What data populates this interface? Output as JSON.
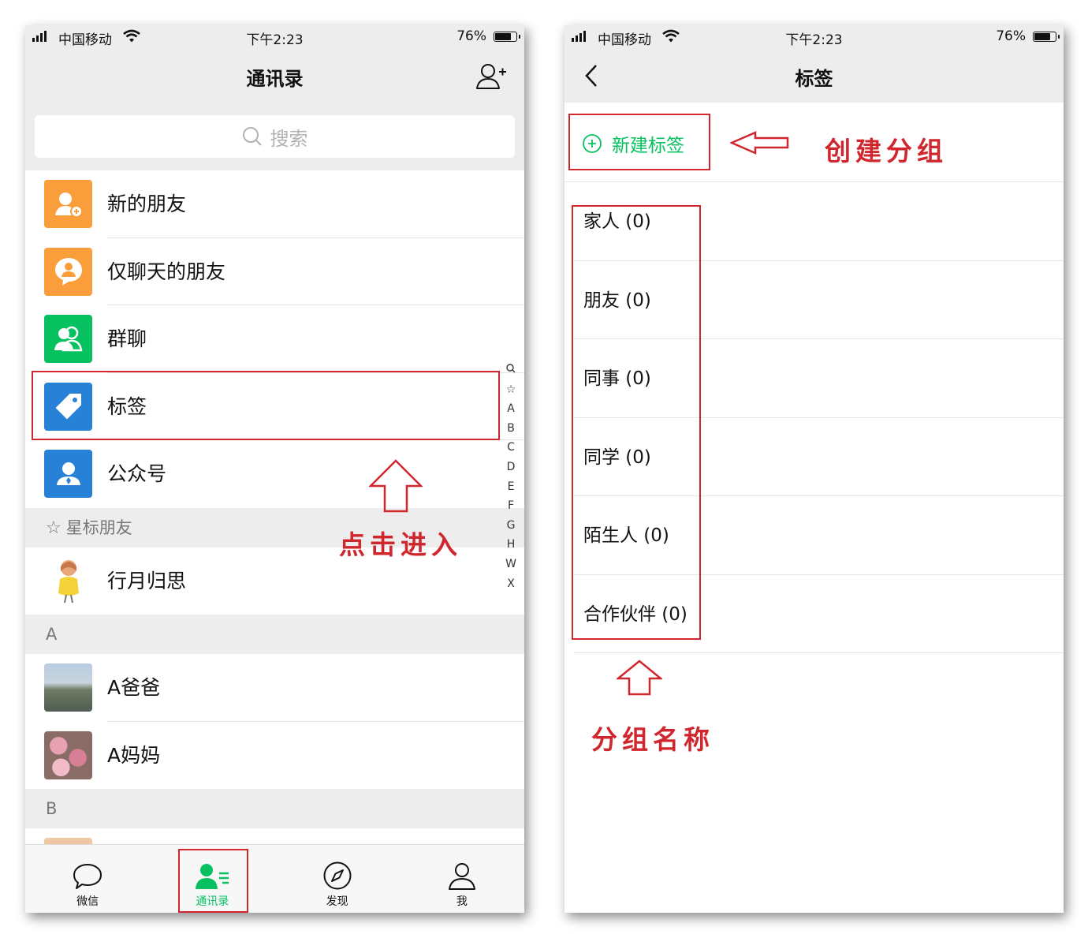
{
  "status_bar": {
    "carrier": "中国移动",
    "time": "下午2:23",
    "battery": "76%"
  },
  "left": {
    "title": "通讯录",
    "search_placeholder": "搜索",
    "menu": [
      {
        "label": "新的朋友",
        "icon": "add-friend-icon",
        "color": "#fa9d3b"
      },
      {
        "label": "仅聊天的朋友",
        "icon": "chat-only-icon",
        "color": "#fa9d3b"
      },
      {
        "label": "群聊",
        "icon": "group-chat-icon",
        "color": "#07c160"
      },
      {
        "label": "标签",
        "icon": "tag-icon",
        "color": "#2782d7"
      },
      {
        "label": "公众号",
        "icon": "official-account-icon",
        "color": "#2782d7"
      }
    ],
    "starred_header": "星标朋友",
    "starred": [
      {
        "label": "行月归思"
      }
    ],
    "section_a": "A",
    "contacts_a": [
      {
        "label": "A爸爸"
      },
      {
        "label": "A妈妈"
      }
    ],
    "section_b": "B",
    "index": [
      "Q",
      "☆",
      "A",
      "B",
      "C",
      "D",
      "E",
      "F",
      "G",
      "H",
      "W",
      "X"
    ],
    "tabs": [
      {
        "label": "微信",
        "icon": "chat-bubble-icon"
      },
      {
        "label": "通讯录",
        "icon": "contacts-icon",
        "active": true
      },
      {
        "label": "发现",
        "icon": "compass-icon"
      },
      {
        "label": "我",
        "icon": "person-icon"
      }
    ],
    "annotation": "点击进入"
  },
  "right": {
    "title": "标签",
    "new_tag_label": "新建标签",
    "tags": [
      "家人 (0)",
      "朋友 (0)",
      "同事 (0)",
      "同学 (0)",
      "陌生人 (0)",
      "合作伙伴 (0)"
    ],
    "annotation_create": "创建分组",
    "annotation_names": "分组名称"
  },
  "colors": {
    "accent_green": "#07c160",
    "annotation_red": "#d0262d"
  }
}
